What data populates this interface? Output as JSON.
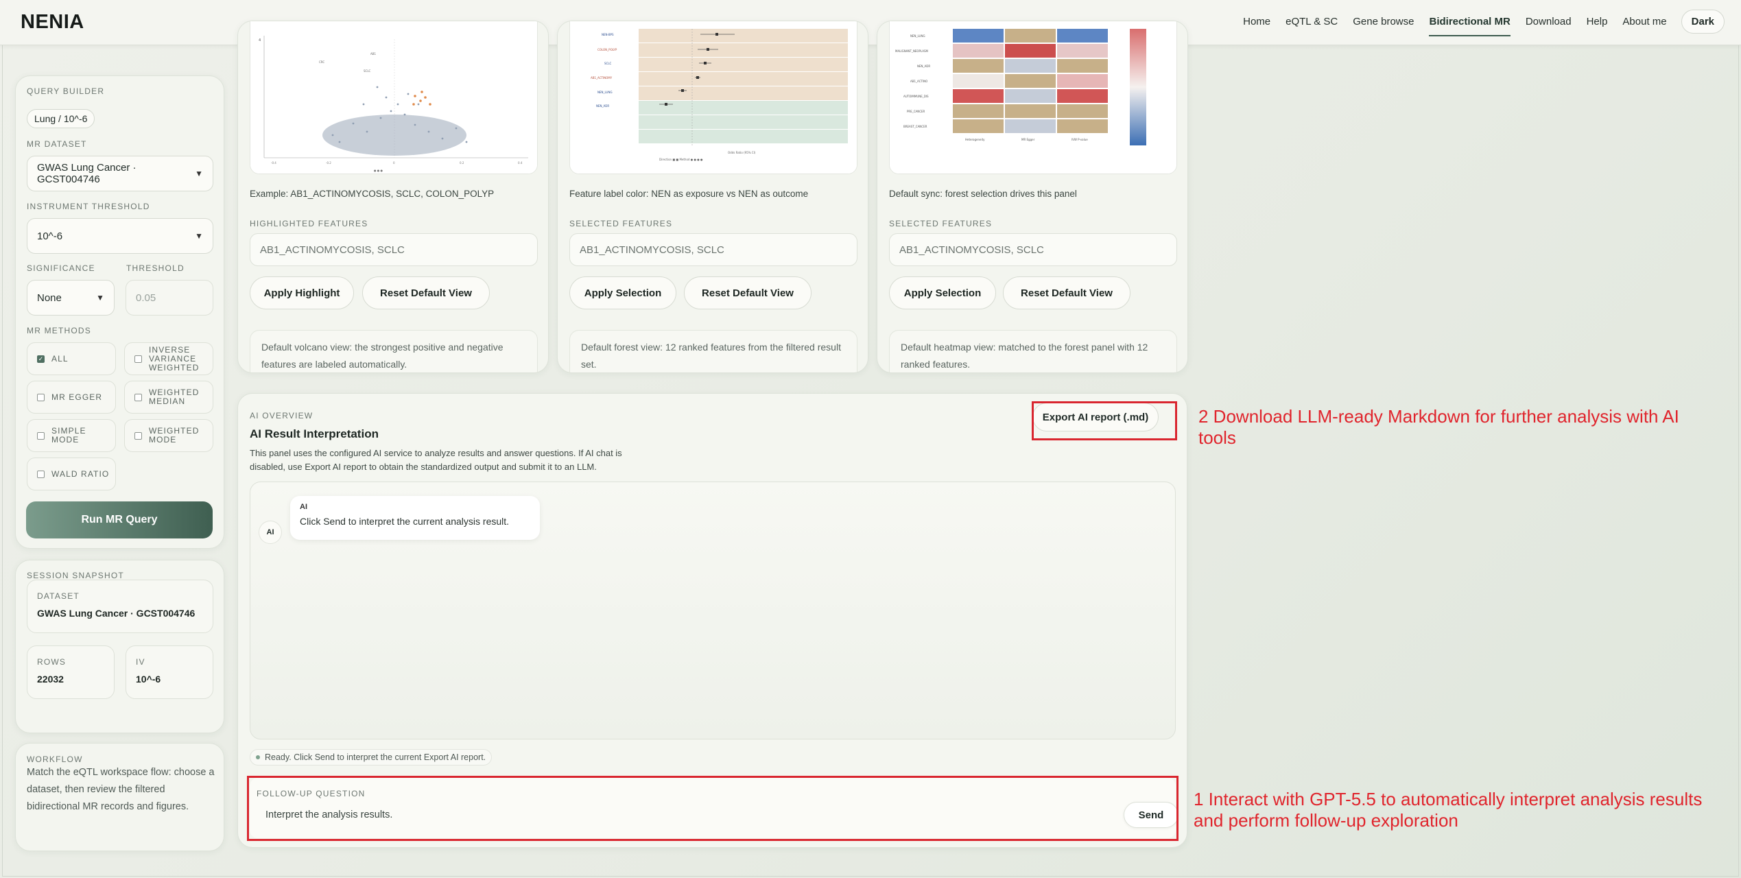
{
  "nav": {
    "brand": "NENIA",
    "links": [
      "Home",
      "eQTL & SC",
      "Gene browse",
      "Bidirectional MR",
      "Download",
      "Help",
      "About me"
    ],
    "active": "Bidirectional MR",
    "dark_toggle": "Dark"
  },
  "query_builder": {
    "title": "QUERY BUILDER",
    "context_pill": "Lung / 10^-6",
    "dataset_label": "MR DATASET",
    "dataset_value": "GWAS Lung Cancer · GCST004746",
    "instrument_label": "INSTRUMENT THRESHOLD",
    "instrument_value": "10^-6",
    "significance_label": "SIGNIFICANCE",
    "significance_value": "None",
    "threshold_label": "THRESHOLD",
    "threshold_placeholder": "0.05",
    "methods_label": "MR METHODS",
    "methods": [
      {
        "label": "ALL",
        "checked": true
      },
      {
        "label": "INVERSE VARIANCE WEIGHTED",
        "checked": false
      },
      {
        "label": "MR EGGER",
        "checked": false
      },
      {
        "label": "WEIGHTED MEDIAN",
        "checked": false
      },
      {
        "label": "SIMPLE MODE",
        "checked": false
      },
      {
        "label": "WEIGHTED MODE",
        "checked": false
      },
      {
        "label": "WALD RATIO",
        "checked": false
      }
    ],
    "run_button": "Run MR Query"
  },
  "session": {
    "title": "SESSION SNAPSHOT",
    "dataset_label": "DATASET",
    "dataset_value": "GWAS Lung Cancer · GCST004746",
    "rows_label": "ROWS",
    "rows_value": "22032",
    "iv_label": "IV",
    "iv_value": "10^-6"
  },
  "workflow": {
    "title": "WORKFLOW",
    "text": "Match the eQTL workspace flow: choose a dataset, then review the filtered bidirectional MR records and figures."
  },
  "panels": [
    {
      "caption": "Example: AB1_ACTINOMYCOSIS, SCLC, COLON_POLYP",
      "features_label": "HIGHLIGHTED FEATURES",
      "features_value": "AB1_ACTINOMYCOSIS, SCLC",
      "primary_button": "Apply Highlight",
      "reset_button": "Reset Default View",
      "info": "Default volcano view: the strongest positive and negative features are labeled automatically."
    },
    {
      "caption": "Feature label color: NEN as exposure vs NEN as outcome",
      "features_label": "SELECTED FEATURES",
      "features_value": "AB1_ACTINOMYCOSIS, SCLC",
      "primary_button": "Apply Selection",
      "reset_button": "Reset Default View",
      "info": "Default forest view: 12 ranked features from the filtered result set."
    },
    {
      "caption": "Default sync: forest selection drives this panel",
      "features_label": "SELECTED FEATURES",
      "features_value": "AB1_ACTINOMYCOSIS, SCLC",
      "primary_button": "Apply Selection",
      "reset_button": "Reset Default View",
      "info": "Default heatmap view: matched to the forest panel with 12 ranked features."
    }
  ],
  "ai": {
    "eyebrow": "AI OVERVIEW",
    "title": "AI Result Interpretation",
    "description": "This panel uses the configured AI service to analyze results and answer questions. If AI chat is disabled, use Export AI report to obtain the standardized output and submit it to an LLM.",
    "export_button": "Export AI report (.md)",
    "avatar": "AI",
    "bubble_sender": "AI",
    "bubble_text": "Click Send to interpret the current analysis result.",
    "status": "Ready. Click Send to interpret the current Export AI report.",
    "followup_label": "FOLLOW-UP QUESTION",
    "followup_value": "Interpret the analysis results.",
    "send_button": "Send"
  },
  "annotations": {
    "note1": "1 Interact with GPT-5.5 to automatically interpret analysis results and perform follow-up exploration",
    "note2": "2 Download LLM-ready Markdown for further analysis with AI tools",
    "color": "#e0242c"
  }
}
